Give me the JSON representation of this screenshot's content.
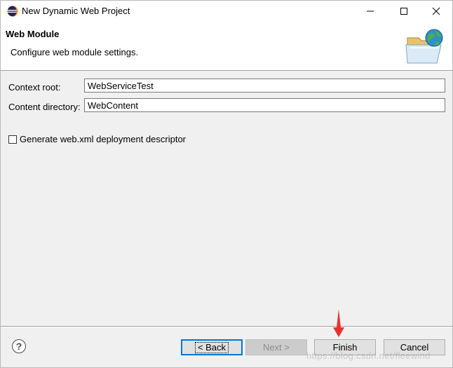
{
  "window": {
    "title": "New Dynamic Web Project",
    "app_icon": "eclipse-icon"
  },
  "banner": {
    "title": "Web Module",
    "description": "Configure web module settings.",
    "icon": "web-folder-globe-icon"
  },
  "form": {
    "context_root_label": "Context root:",
    "context_root_value": "WebServiceTest",
    "content_directory_label": "Content directory:",
    "content_directory_value": "WebContent",
    "generate_label": "Generate web.xml deployment descriptor",
    "generate_checked": false
  },
  "buttons": {
    "help": "?",
    "back": "< Back",
    "next": "Next >",
    "finish": "Finish",
    "cancel": "Cancel"
  },
  "annotation": {
    "arrow_color": "#e8312f"
  },
  "watermark": "https://blog.csdn.net/fleewind",
  "colors": {
    "focus_border": "#0078d7",
    "dialog_bg": "#f0f0f0"
  }
}
